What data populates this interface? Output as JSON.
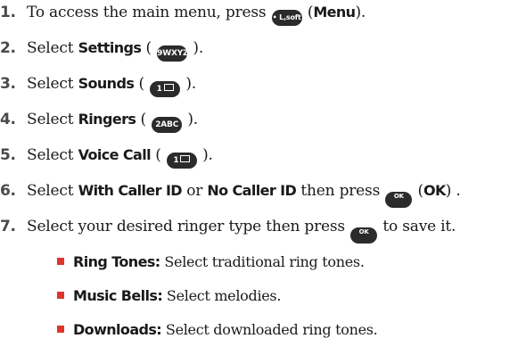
{
  "steps": [
    {
      "num": "1.",
      "pre": "To access the main menu, press",
      "key": "• L,soft",
      "post_open": " (",
      "bold": "Menu",
      "post_close": ")."
    },
    {
      "num": "2.",
      "pre": "Select",
      "bold": "Settings",
      "open": " (",
      "key": "9WXYZ",
      "close": ")."
    },
    {
      "num": "3.",
      "pre": "Select",
      "bold": "Sounds",
      "open": " (",
      "key": "1",
      "close": ")."
    },
    {
      "num": "4.",
      "pre": "Select",
      "bold": "Ringers",
      "open": " (",
      "key": "2ABC",
      "close": ")."
    },
    {
      "num": "5.",
      "pre": "Select",
      "bold": "Voice Call",
      "open": " (",
      "key": "1",
      "close": ")."
    },
    {
      "num": "6.",
      "pre": "Select",
      "bold1": "With Caller ID",
      "mid": " or ",
      "bold2": "No Caller ID",
      "then": " then press",
      "key": "OK",
      "open": " (",
      "bold3": "OK",
      "close": ") ."
    },
    {
      "num": "7.",
      "pre": "Select your desired ringer type then press",
      "key": "OK",
      "post": "to save it."
    }
  ],
  "bullets": [
    {
      "term": "Ring Tones:",
      "desc": "Select traditional ring tones."
    },
    {
      "term": "Music Bells:",
      "desc": "Select melodies."
    },
    {
      "term": "Downloads:",
      "desc": "Select downloaded ring tones."
    }
  ],
  "colors": {
    "bullet": "#e0352b",
    "key_bg": "#2b2b2b",
    "number": "#4a4a4a"
  },
  "icons": {
    "menu_key": "left-softkey-icon",
    "ok_key": "ok-key-icon",
    "nine_key": "9-key-icon",
    "one_key": "1-key-icon",
    "two_key": "2-key-icon"
  }
}
